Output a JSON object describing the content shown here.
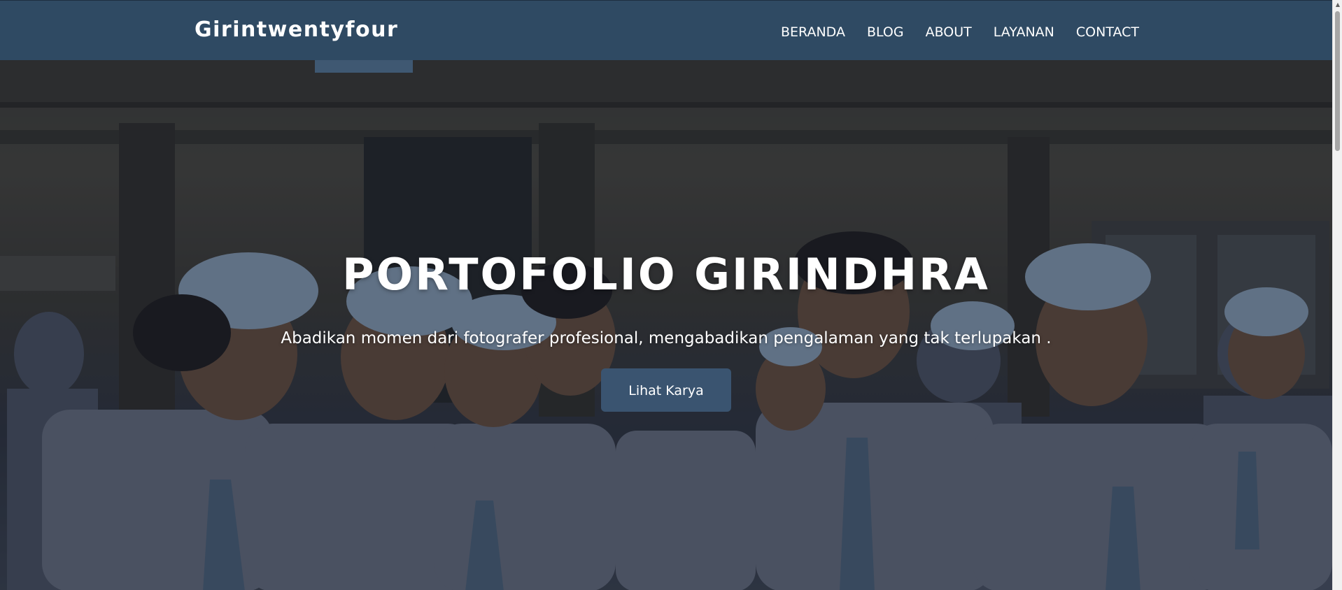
{
  "navbar": {
    "brand": "Girintwentyfour",
    "links": [
      {
        "label": "BERANDA"
      },
      {
        "label": "BLOG"
      },
      {
        "label": "ABOUT"
      },
      {
        "label": "LAYANAN"
      },
      {
        "label": "CONTACT"
      }
    ],
    "background": "#2f4a63"
  },
  "hero": {
    "title": "PORTOFOLIO GIRINDHRA",
    "subtitle": "Abadikan momen dari fotografer profesional, mengabadikan pengalaman yang tak terlupakan .",
    "button_label": "Lihat Karya",
    "button_color": "#3a5470",
    "background_image": "group photo of students in white uniforms and caps"
  },
  "scrollbar": {
    "up_icon": "scroll-up-arrow-icon"
  }
}
